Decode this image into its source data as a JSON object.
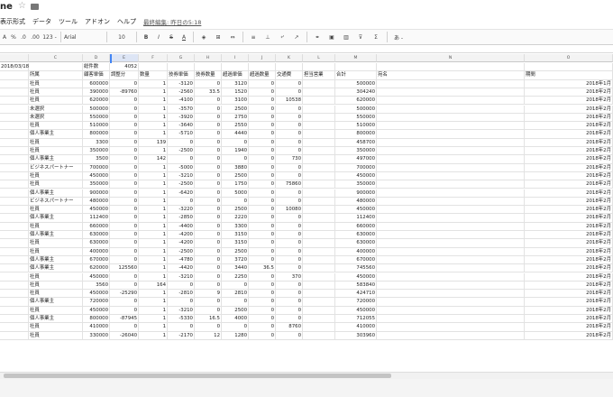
{
  "title": {
    "name": "ne"
  },
  "menu": [
    "表示形式",
    "データ",
    "ツール",
    "アドオン",
    "ヘルプ"
  ],
  "last_edit": "最終編集: 昨日の5:18",
  "toolbar": {
    "zoom_a": "A",
    "zoom_pct": "%",
    ".0": ".0",
    ".00": ".00",
    "fmt": "123 -",
    "font": "Arial",
    "size": "10",
    "bold": "B",
    "italic": "I",
    "strike": "S",
    "color": "A",
    "more": "あ -"
  },
  "col_headers": [
    "",
    "C",
    "D",
    "E",
    "F",
    "G",
    "H",
    "I",
    "J",
    "K",
    "L",
    "M",
    "N",
    "O"
  ],
  "top": {
    "date": "2018/03/18",
    "count_label": "総件数",
    "count": "4052"
  },
  "headers": [
    "所属",
    "顧客単価",
    "調整分",
    "数量",
    "技券単価",
    "技券数量",
    "超過単価",
    "超過数量",
    "交通費",
    "担当営業",
    "合計",
    "宛名",
    "期間"
  ],
  "rows": [
    [
      "社員",
      "600000",
      "0",
      "1",
      "-3120",
      "0",
      "3120",
      "0",
      "0",
      "",
      "500000",
      "",
      "2018年1月"
    ],
    [
      "社員",
      "390000",
      "-89760",
      "1",
      "-2560",
      "33.5",
      "1520",
      "0",
      "0",
      "",
      "304240",
      "",
      "2018年2月"
    ],
    [
      "社員",
      "620000",
      "0",
      "1",
      "-4100",
      "0",
      "3100",
      "0",
      "10538",
      "",
      "620000",
      "",
      "2018年2月"
    ],
    [
      "未選択",
      "500000",
      "0",
      "1",
      "-3570",
      "0",
      "2500",
      "0",
      "0",
      "",
      "500000",
      "",
      "2018年2月"
    ],
    [
      "未選択",
      "550000",
      "0",
      "1",
      "-3920",
      "0",
      "2750",
      "0",
      "0",
      "",
      "550000",
      "",
      "2018年2月"
    ],
    [
      "社員",
      "510000",
      "0",
      "1",
      "-3640",
      "0",
      "2550",
      "0",
      "0",
      "",
      "510000",
      "",
      "2018年2月"
    ],
    [
      "個人事業主",
      "800000",
      "0",
      "1",
      "-5710",
      "0",
      "4440",
      "0",
      "0",
      "",
      "800000",
      "",
      "2018年2月"
    ],
    [
      "社員",
      "3300",
      "0",
      "139",
      "0",
      "0",
      "0",
      "0",
      "0",
      "",
      "458700",
      "",
      "2018年2月"
    ],
    [
      "社員",
      "350000",
      "0",
      "1",
      "-2500",
      "0",
      "1940",
      "0",
      "0",
      "",
      "350000",
      "",
      "2018年2月"
    ],
    [
      "個人事業主",
      "3500",
      "0",
      "142",
      "0",
      "0",
      "0",
      "0",
      "730",
      "",
      "497000",
      "",
      "2018年2月"
    ],
    [
      "ビジネスパートナー",
      "700000",
      "0",
      "1",
      "-5000",
      "0",
      "3880",
      "0",
      "0",
      "",
      "700000",
      "",
      "2018年2月"
    ],
    [
      "社員",
      "450000",
      "0",
      "1",
      "-3210",
      "0",
      "2500",
      "0",
      "0",
      "",
      "450000",
      "",
      "2018年2月"
    ],
    [
      "社員",
      "350000",
      "0",
      "1",
      "-2500",
      "0",
      "1750",
      "0",
      "75860",
      "",
      "350000",
      "",
      "2018年2月"
    ],
    [
      "個人事業主",
      "900000",
      "0",
      "1",
      "-6420",
      "0",
      "5000",
      "0",
      "0",
      "",
      "900000",
      "",
      "2018年2月"
    ],
    [
      "ビジネスパートナー",
      "480000",
      "0",
      "1",
      "0",
      "0",
      "0",
      "0",
      "0",
      "",
      "480000",
      "",
      "2018年2月"
    ],
    [
      "社員",
      "450000",
      "0",
      "1",
      "-3220",
      "0",
      "2500",
      "0",
      "10080",
      "",
      "450000",
      "",
      "2018年2月"
    ],
    [
      "個人事業主",
      "112400",
      "0",
      "1",
      "-2850",
      "0",
      "2220",
      "0",
      "0",
      "",
      "112400",
      "",
      "2018年2月"
    ],
    [
      "社員",
      "660000",
      "0",
      "1",
      "-4400",
      "0",
      "3300",
      "0",
      "0",
      "",
      "660000",
      "",
      "2018年2月"
    ],
    [
      "個人事業主",
      "630000",
      "0",
      "1",
      "-4200",
      "0",
      "3150",
      "0",
      "0",
      "",
      "630000",
      "",
      "2018年2月"
    ],
    [
      "社員",
      "630000",
      "0",
      "1",
      "-4200",
      "0",
      "3150",
      "0",
      "0",
      "",
      "630000",
      "",
      "2018年2月"
    ],
    [
      "社員",
      "400000",
      "0",
      "1",
      "-2500",
      "0",
      "2500",
      "0",
      "0",
      "",
      "400000",
      "",
      "2018年2月"
    ],
    [
      "個人事業主",
      "670000",
      "0",
      "1",
      "-4780",
      "0",
      "3720",
      "0",
      "0",
      "",
      "670000",
      "",
      "2018年2月"
    ],
    [
      "個人事業主",
      "620000",
      "125560",
      "1",
      "-4420",
      "0",
      "3440",
      "36.5",
      "0",
      "",
      "745560",
      "",
      "2018年2月"
    ],
    [
      "社員",
      "450000",
      "0",
      "1",
      "-3210",
      "0",
      "2250",
      "0",
      "370",
      "",
      "450000",
      "",
      "2018年2月"
    ],
    [
      "社員",
      "3560",
      "0",
      "164",
      "0",
      "0",
      "0",
      "0",
      "0",
      "",
      "583840",
      "",
      "2018年2月"
    ],
    [
      "社員",
      "450000",
      "-25290",
      "1",
      "-2810",
      "9",
      "2810",
      "0",
      "0",
      "",
      "424710",
      "",
      "2018年2月"
    ],
    [
      "個人事業主",
      "720000",
      "0",
      "1",
      "0",
      "0",
      "0",
      "0",
      "0",
      "",
      "720000",
      "",
      "2018年2月"
    ],
    [
      "社員",
      "450000",
      "0",
      "1",
      "-3210",
      "0",
      "2500",
      "0",
      "0",
      "",
      "450000",
      "",
      "2018年2月"
    ],
    [
      "個人事業主",
      "800000",
      "-87945",
      "1",
      "-5330",
      "16.5",
      "4000",
      "0",
      "0",
      "",
      "712055",
      "",
      "2018年2月"
    ],
    [
      "社員",
      "410000",
      "0",
      "1",
      "0",
      "0",
      "0",
      "0",
      "8760",
      "",
      "410000",
      "",
      "2018年2月"
    ],
    [
      "社員",
      "330000",
      "-26040",
      "1",
      "-2170",
      "12",
      "1280",
      "0",
      "0",
      "",
      "303960",
      "",
      "2018年2月"
    ]
  ]
}
